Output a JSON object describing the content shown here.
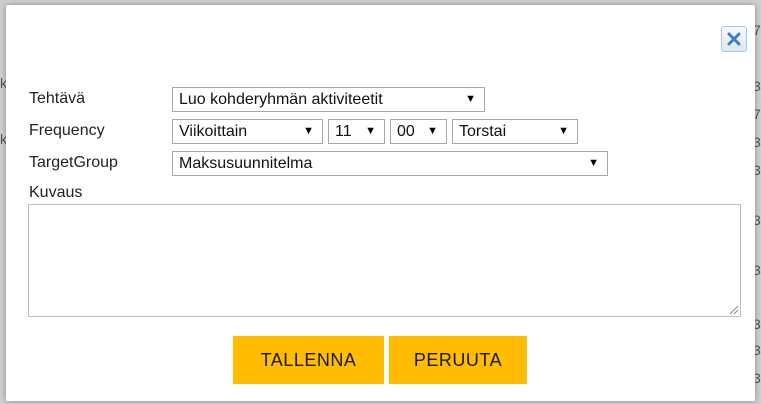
{
  "background_fragments": [
    "7",
    "ki",
    "3",
    "7",
    "3",
    "3",
    "3",
    "3",
    "3",
    "3",
    "3"
  ],
  "dialog": {
    "fields": {
      "task_label": "Tehtävä",
      "task_value": "Luo kohderyhmän aktiviteetit",
      "frequency_label": "Frequency",
      "frequency_period": "Viikoittain",
      "frequency_hour": "11",
      "frequency_minute": "00",
      "frequency_weekday": "Torstai",
      "target_group_label": "TargetGroup",
      "target_group_value": "Maksusuunnitelma",
      "description_label": "Kuvaus",
      "description_value": ""
    },
    "buttons": {
      "save_label": "TALLENNA",
      "cancel_label": "PERUUTA"
    },
    "colors": {
      "button_bg": "#ffbc00",
      "close_icon": "#3d7fc1"
    }
  }
}
